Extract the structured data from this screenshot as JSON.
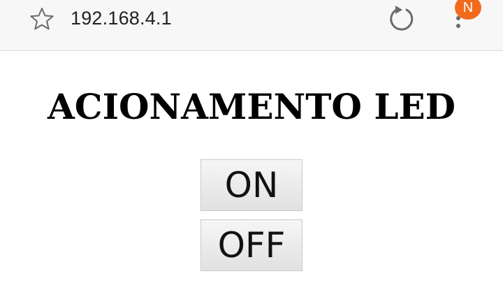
{
  "browser": {
    "url": "192.168.4.1",
    "icons": {
      "bookmark": "star-icon",
      "reload": "reload-icon",
      "menu": "overflow-menu-icon"
    },
    "notification_badge": {
      "label": "N",
      "color": "#f26b1d"
    }
  },
  "page": {
    "title": "ACIONAMENTO LED",
    "buttons": {
      "on_label": "ON",
      "off_label": "OFF"
    }
  }
}
